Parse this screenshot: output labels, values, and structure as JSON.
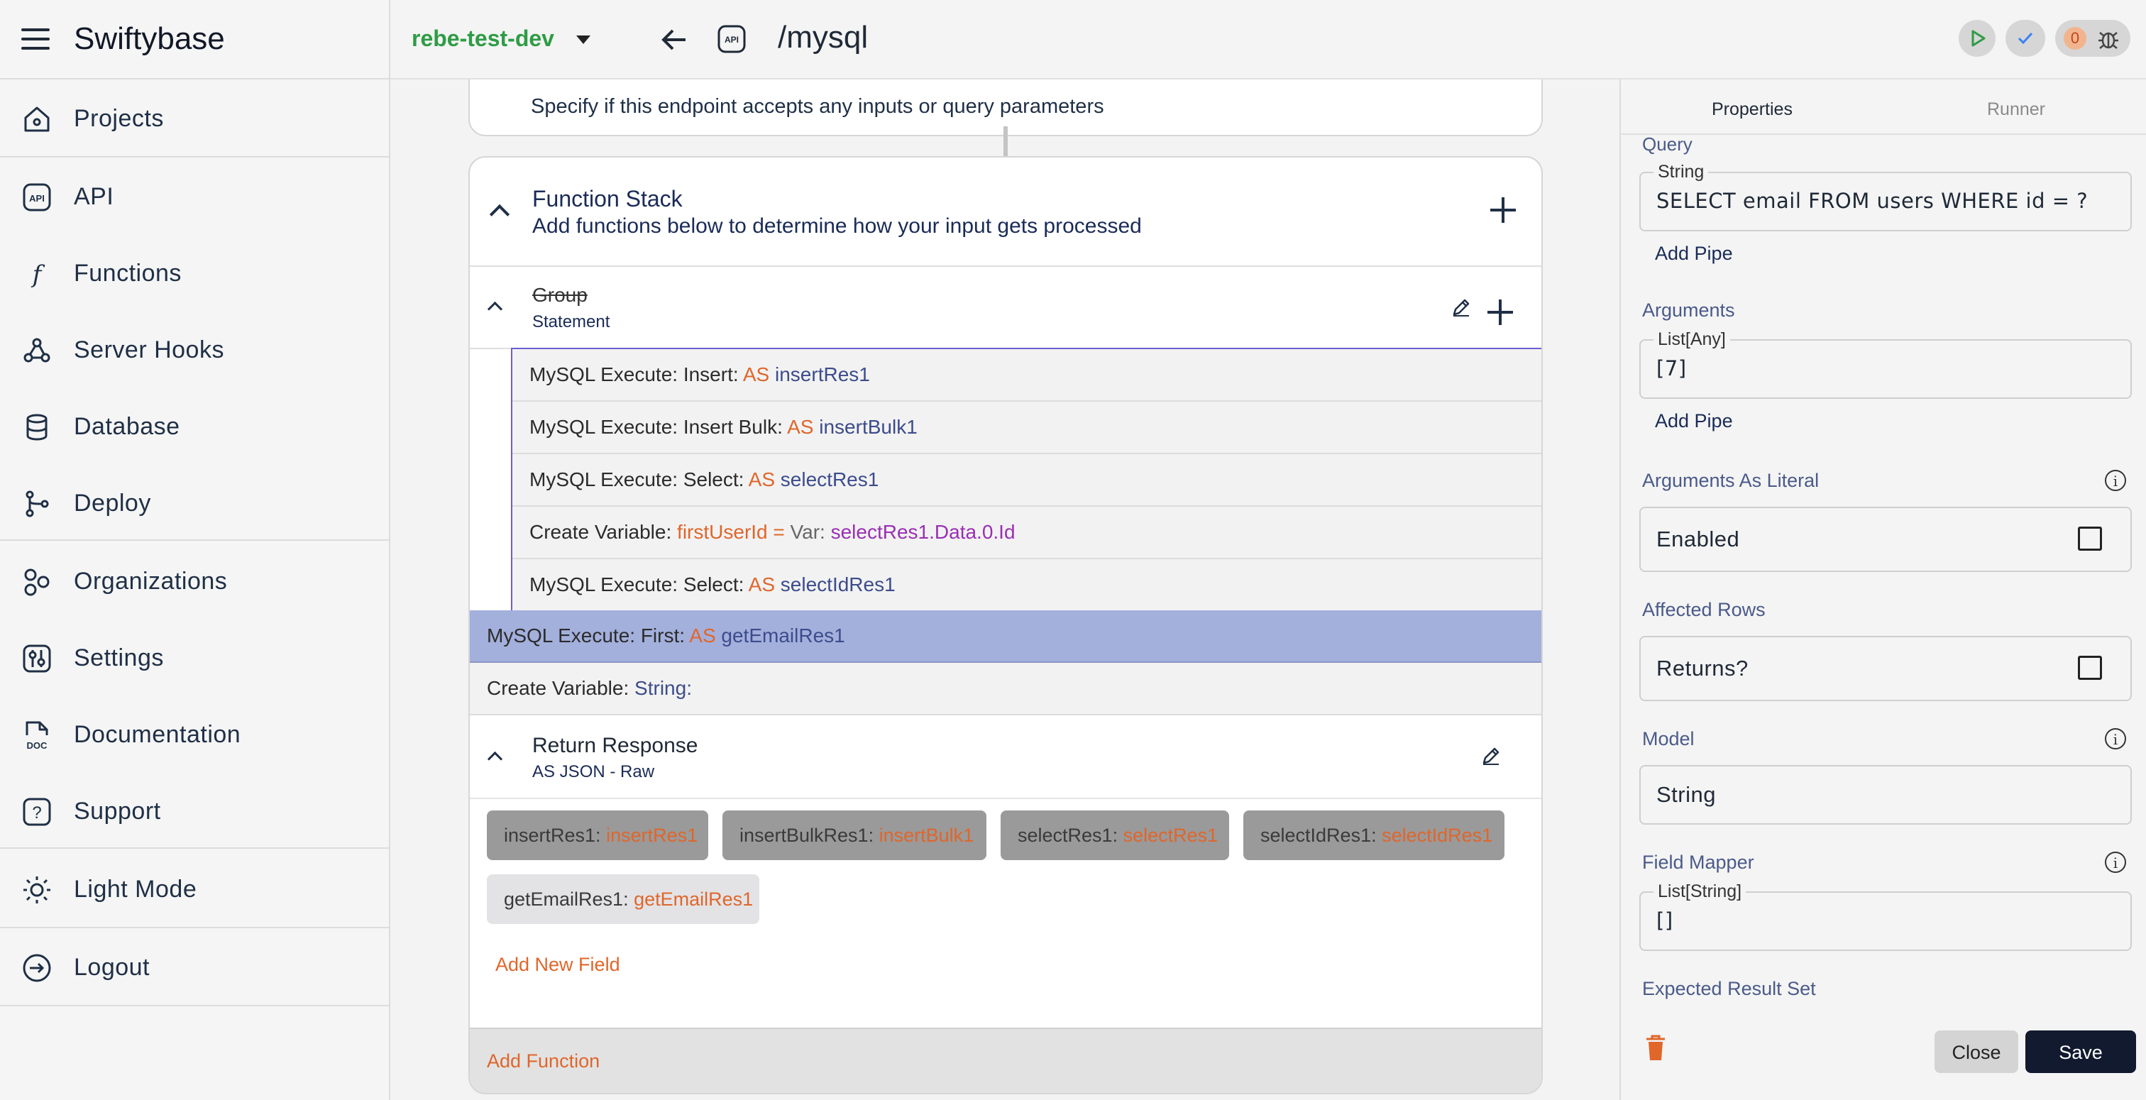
{
  "app": {
    "title": "Swiftybase"
  },
  "sidebar": {
    "items": [
      {
        "label": "Projects",
        "icon": "home-icon"
      },
      {
        "label": "API",
        "icon": "api-icon"
      },
      {
        "label": "Functions",
        "icon": "function-icon"
      },
      {
        "label": "Server Hooks",
        "icon": "webhook-icon"
      },
      {
        "label": "Database",
        "icon": "database-icon"
      },
      {
        "label": "Deploy",
        "icon": "git-branch-icon"
      },
      {
        "label": "Organizations",
        "icon": "organizations-icon"
      },
      {
        "label": "Settings",
        "icon": "settings-icon"
      },
      {
        "label": "Documentation",
        "icon": "doc-icon"
      },
      {
        "label": "Support",
        "icon": "help-icon"
      },
      {
        "label": "Light Mode",
        "icon": "sun-icon"
      },
      {
        "label": "Logout",
        "icon": "logout-icon"
      }
    ]
  },
  "topbar": {
    "workspace": "rebe-test-dev",
    "api_badge": "API",
    "endpoint": "/mysql",
    "error_count": "0",
    "colors": {
      "run": "#2e9c45",
      "check": "#3b82f6",
      "count": "#e0662a"
    }
  },
  "main": {
    "input_desc": "Specify if this endpoint accepts any inputs or query parameters",
    "stack": {
      "title": "Function Stack",
      "subtitle": "Add functions below to determine how your input gets processed",
      "group": {
        "title": "Group",
        "subtitle": "Statement"
      },
      "group_rows": [
        {
          "prefix": "MySQL Execute: Insert:",
          "as": "AS",
          "var": "insertRes1"
        },
        {
          "prefix": "MySQL Execute: Insert Bulk:",
          "as": "AS",
          "var": "insertBulk1"
        },
        {
          "prefix": "MySQL Execute: Select:",
          "as": "AS",
          "var": "selectRes1"
        },
        {
          "prefix": "MySQL Execute: Select:",
          "as": "AS",
          "var": "selectIdRes1"
        }
      ],
      "create_var_row": {
        "prefix": "Create Variable:",
        "name": "firstUserId",
        "eq": "=",
        "type": "Var:",
        "value": "selectRes1.Data.0.Id"
      },
      "selected_row": {
        "prefix": "MySQL Execute: First:",
        "as": "AS",
        "var": "getEmailRes1"
      },
      "create_string_row": {
        "prefix": "Create Variable:",
        "type": "String:"
      },
      "return": {
        "title": "Return Response",
        "subtitle": "AS JSON - Raw"
      },
      "fields": [
        {
          "key": "insertRes1:",
          "value": "insertRes1"
        },
        {
          "key": "insertBulkRes1:",
          "value": "insertBulk1"
        },
        {
          "key": "selectRes1:",
          "value": "selectRes1"
        },
        {
          "key": "selectIdRes1:",
          "value": "selectIdRes1"
        },
        {
          "key": "getEmailRes1:",
          "value": "getEmailRes1"
        }
      ],
      "add_field": "Add New Field",
      "add_function": "Add Function"
    }
  },
  "panel": {
    "tabs": [
      "Properties",
      "Runner"
    ],
    "query": {
      "label": "Query",
      "type": "String",
      "value": "SELECT email FROM users WHERE id = ?",
      "add_pipe": "Add Pipe"
    },
    "arguments": {
      "label": "Arguments",
      "type": "List[Any]",
      "value": "[7]",
      "add_pipe": "Add Pipe"
    },
    "args_literal": {
      "label": "Arguments As Literal",
      "value": "Enabled",
      "checked": false
    },
    "affected_rows": {
      "label": "Affected Rows",
      "value": "Returns?",
      "checked": false
    },
    "model": {
      "label": "Model",
      "value": "String"
    },
    "field_mapper": {
      "label": "Field Mapper",
      "type": "List[String]",
      "value": "[]"
    },
    "expected_result": {
      "label": "Expected Result Set"
    },
    "close": "Close",
    "save": "Save"
  }
}
